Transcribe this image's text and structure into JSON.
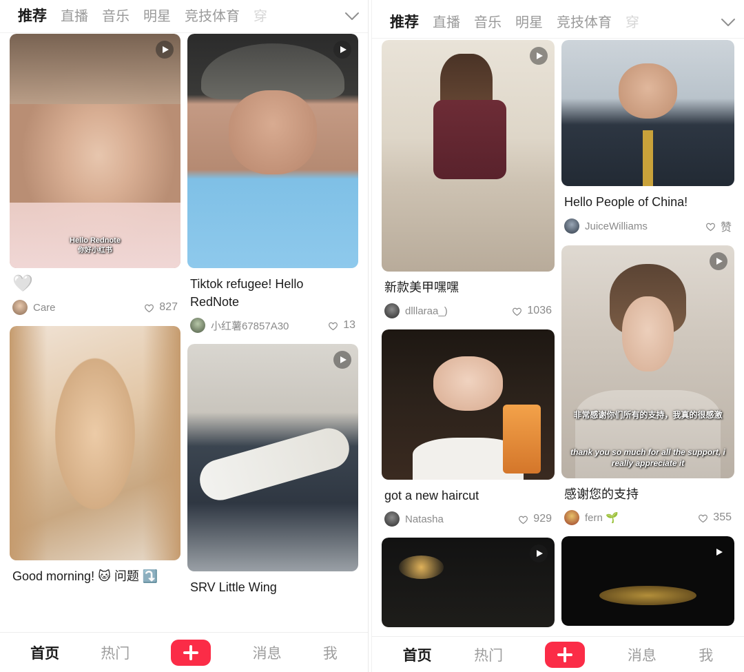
{
  "app": {
    "accent_red": "#fb2c47",
    "indicator_color": "#f0273f"
  },
  "tabs": {
    "items": [
      {
        "label": "推荐",
        "active": true
      },
      {
        "label": "直播",
        "active": false
      },
      {
        "label": "音乐",
        "active": false
      },
      {
        "label": "明星",
        "active": false
      },
      {
        "label": "竞技体育",
        "active": false
      },
      {
        "label": "穿",
        "active": false,
        "faded": true
      }
    ],
    "chevron_icon": "chevron-down-icon"
  },
  "left_panel": {
    "column_a": [
      {
        "id": "card-care",
        "title": "🤍",
        "title_is_emoji": true,
        "author": "Care",
        "likes": "827",
        "has_play": true,
        "image_class": "img-girl-sleep",
        "overlay_line1": "Hello Rednote",
        "overlay_line2": "你好小红书",
        "thumb_h": 340
      },
      {
        "id": "card-good-morning",
        "title": "Good morning! 🐱 问题 ⤵️",
        "title_is_emoji": false,
        "author": "",
        "likes": "",
        "has_play": false,
        "image_class": "img-blonde",
        "overlay_line1": "",
        "overlay_line2": "",
        "thumb_h": 340
      }
    ],
    "column_b": [
      {
        "id": "card-tiktok-refugee",
        "title": "Tiktok refugee! Hello RedNote",
        "title_is_emoji": false,
        "author": "小红薯67857A30",
        "likes": "13",
        "has_play": true,
        "image_class": "img-beard",
        "overlay_line1": "",
        "overlay_line2": "",
        "thumb_h": 340
      },
      {
        "id": "card-srv-little-wing",
        "title": "SRV Little Wing",
        "title_is_emoji": false,
        "author": "",
        "likes": "",
        "has_play": true,
        "image_class": "img-guitar",
        "overlay_line1": "",
        "overlay_line2": "",
        "thumb_h": 330
      }
    ]
  },
  "right_panel": {
    "column_a": [
      {
        "id": "card-nail-art",
        "title": "新款美甲嘿嘿",
        "title_is_emoji": false,
        "author": "dlllaraa_)",
        "likes": "1036",
        "has_play": true,
        "image_class": "img-tall-girl",
        "overlay_line1": "",
        "overlay_line2": "",
        "thumb_h": 336
      },
      {
        "id": "card-new-haircut",
        "title": "got a new haircut",
        "title_is_emoji": false,
        "author": "Natasha",
        "likes": "929",
        "has_play": false,
        "image_class": "img-redhair",
        "overlay_line1": "",
        "overlay_line2": "",
        "thumb_h": 218
      },
      {
        "id": "card-dark-room",
        "title": "",
        "title_is_emoji": false,
        "author": "",
        "likes": "",
        "has_play": true,
        "image_class": "img-darkroom",
        "overlay_line1": "",
        "overlay_line2": "",
        "thumb_h": 130
      }
    ],
    "column_b": [
      {
        "id": "card-hello-people-of-china",
        "title": "Hello People of China!",
        "title_is_emoji": false,
        "author": "JuiceWilliams",
        "likes": "赞",
        "has_play": false,
        "image_class": "img-suit",
        "overlay_line1": "",
        "overlay_line2": "",
        "thumb_h": 212
      },
      {
        "id": "card-thank-you-support",
        "title": "感谢您的支持",
        "title_is_emoji": false,
        "author": "fern 🌱",
        "likes": "355",
        "has_play": true,
        "image_class": "img-shortgirl",
        "overlay_line1": "非常感谢你们所有的支持，我真的很感激",
        "overlay_line2": "thank you so much for all the support, i really appreciate it",
        "thumb_h": 338
      },
      {
        "id": "card-drums",
        "title": "",
        "title_is_emoji": false,
        "author": "",
        "likes": "",
        "has_play": true,
        "image_class": "img-dark",
        "overlay_line1": "",
        "overlay_line2": "",
        "thumb_h": 130
      }
    ]
  },
  "bottom_nav": {
    "items": [
      {
        "label": "首页",
        "active": true
      },
      {
        "label": "热门",
        "active": false
      },
      {
        "label": "消息",
        "active": false
      },
      {
        "label": "我",
        "active": false
      }
    ],
    "plus_icon": "plus-icon"
  }
}
